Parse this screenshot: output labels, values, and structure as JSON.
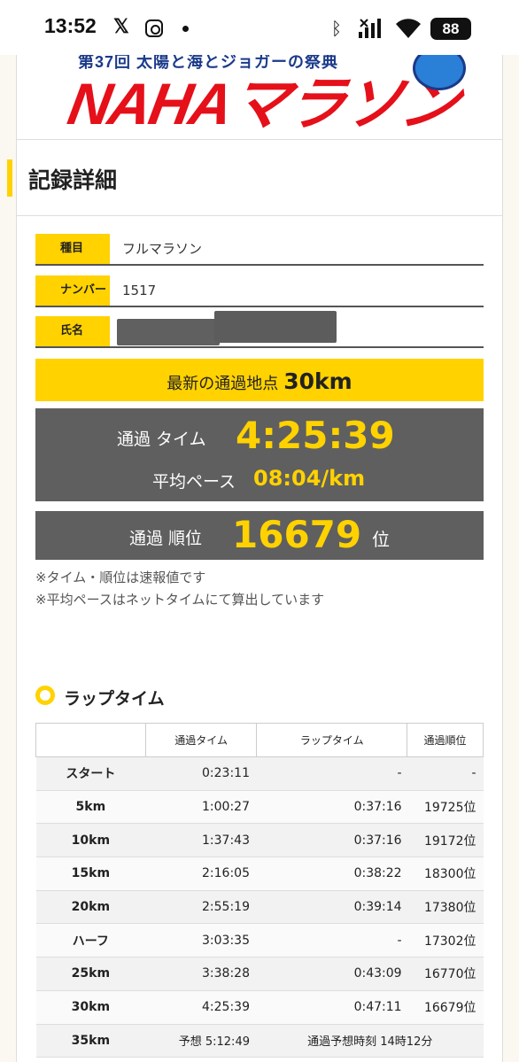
{
  "status_bar": {
    "time": "13:52",
    "x_glyph": "𝕏",
    "battery": "88",
    "icons": [
      "x-icon",
      "instagram-icon",
      "notification-dot-icon",
      "bluetooth-icon",
      "signal-icon",
      "wifi-icon",
      "battery-icon"
    ]
  },
  "banner": {
    "top_text": "第37回 太陽と海とジョガーの祭典",
    "logo_text": "NAHAマラソン"
  },
  "section": {
    "title": "記録詳細"
  },
  "info": {
    "event_label": "種目",
    "event_value": "フルマラソン",
    "number_label": "ナンバー",
    "number_value": "1517",
    "name_label": "氏名"
  },
  "latest": {
    "label": "最新の通過地点",
    "value": "30km"
  },
  "time_box": {
    "pass_time_label": "通過 タイム",
    "pass_time_value": "4:25:39",
    "pace_label": "平均ペース",
    "pace_value": "08:04/km"
  },
  "rank_box": {
    "label": "通過 順位",
    "value": "16679",
    "unit": "位"
  },
  "notes": [
    "※タイム・順位は速報値です",
    "※平均ペースはネットタイムにて算出しています"
  ],
  "lap": {
    "heading": "ラップタイム",
    "headers": [
      "",
      "通過タイム",
      "ラップタイム",
      "通過順位"
    ],
    "rows": [
      {
        "point": "スタート",
        "time": "0:23:11",
        "lap": "-",
        "rank": "-"
      },
      {
        "point": "5km",
        "time": "1:00:27",
        "lap": "0:37:16",
        "rank": "19725位"
      },
      {
        "point": "10km",
        "time": "1:37:43",
        "lap": "0:37:16",
        "rank": "19172位"
      },
      {
        "point": "15km",
        "time": "2:16:05",
        "lap": "0:38:22",
        "rank": "18300位"
      },
      {
        "point": "20km",
        "time": "2:55:19",
        "lap": "0:39:14",
        "rank": "17380位"
      },
      {
        "point": "ハーフ",
        "time": "3:03:35",
        "lap": "-",
        "rank": "17302位"
      },
      {
        "point": "25km",
        "time": "3:38:28",
        "lap": "0:43:09",
        "rank": "16770位"
      },
      {
        "point": "30km",
        "time": "4:25:39",
        "lap": "0:47:11",
        "rank": "16679位"
      }
    ],
    "predicted": {
      "point": "35km",
      "time": "予想 5:12:49",
      "eta": "通過予想時刻 14時12分"
    }
  },
  "colors": {
    "accent_yellow": "#ffd200",
    "box_gray": "#5f5f5f",
    "logo_red": "#e5101a"
  }
}
